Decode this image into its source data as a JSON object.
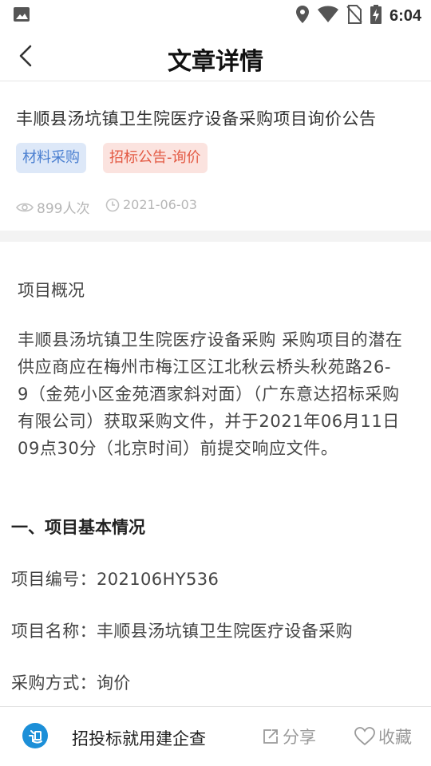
{
  "status_bar": {
    "time": "6:04",
    "icons": [
      "image-icon",
      "location-icon",
      "wifi-icon",
      "no-sim-icon",
      "battery-charging-icon"
    ]
  },
  "nav": {
    "title": "文章详情",
    "back_icon": "chevron-left-icon"
  },
  "article": {
    "title": "丰顺县汤坑镇卫生院医疗设备采购项目询价公告",
    "tags": [
      "材料采购",
      "招标公告-询价"
    ],
    "views": "899人次",
    "date": "2021-06-03"
  },
  "content": {
    "overview_title": "项目概况",
    "overview_lines": [
      "丰顺县汤坑镇卫生院医疗设备采购 采购项目的潜在",
      "供应商应在梅州市梅江区江北秋云桥头秋苑路26-",
      "9（金苑小区金苑酒家斜对面）（广东意达招标采购",
      "有限公司）获取采购文件，并于2021年06月11日",
      "09点30分（北京时间）前提交响应文件。"
    ],
    "section_heading": "一、项目基本情况",
    "rows": [
      "项目编号：202106HY536",
      "项目名称：丰顺县汤坑镇卫生院医疗设备采购",
      "采购方式：询价"
    ]
  },
  "bottom_bar": {
    "promo": "招投标就用建企查",
    "share": "分享",
    "favorite": "收藏"
  },
  "colors": {
    "tag_blue_bg": "#dde8f8",
    "tag_blue_text": "#4a7fd0",
    "tag_red_bg": "#fbe3df",
    "tag_red_text": "#e35a44",
    "logo": "#1c8fd8"
  }
}
